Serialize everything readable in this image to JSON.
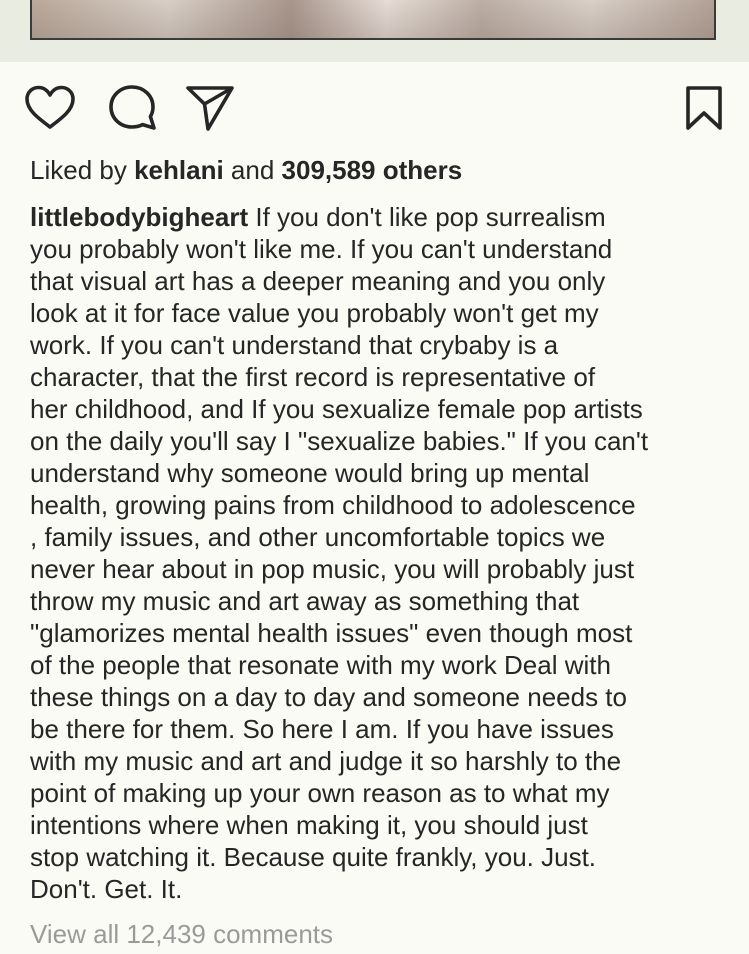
{
  "post": {
    "actions": {
      "like_icon": "heart-icon",
      "comment_icon": "comment-icon",
      "share_icon": "paper-plane-icon",
      "save_icon": "bookmark-icon"
    },
    "likes": {
      "prefix": "Liked by",
      "user": "kehlani",
      "middle": "and",
      "count": "309,589 others"
    },
    "caption": {
      "username": "littlebodybigheart",
      "first_line_text": " If you don't like pop surrealism",
      "lines": [
        "you probably won't like me. If you can't understand",
        "that visual art has a deeper meaning and you only",
        "look at it for face value you probably won't get my",
        "work. If you can't understand that crybaby is a",
        "character, that the first record is representative of",
        "her childhood, and If you sexualize female pop artists",
        "on the daily you'll say I \"sexualize babies.\" If you can't",
        "understand why someone would bring up mental",
        "health, growing pains from childhood to adolescence",
        ", family issues, and other uncomfortable topics we",
        "never hear about in pop music, you will probably just",
        "throw my music and art away as something that",
        "\"glamorizes mental health issues\" even though most",
        "of the people that resonate with my work Deal with",
        "these things on a day to day and someone needs to",
        "be there for them. So here I am. If you have issues",
        "with my music and art and judge it so harshly to the",
        "point of making up your own reason as to what my",
        "intentions where when making it, you should just",
        "stop watching it. Because quite frankly, you. Just.",
        "Don't. Get. It."
      ]
    },
    "comments_link": "View all 12,439 comments"
  }
}
